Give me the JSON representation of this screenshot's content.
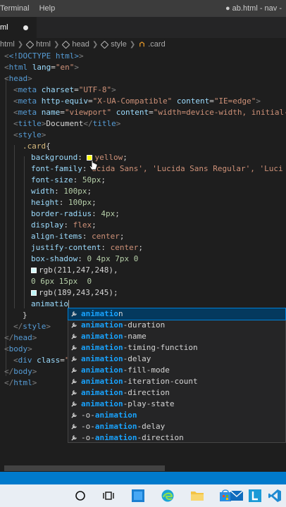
{
  "menubar": {
    "items": [
      "Terminal",
      "Help"
    ],
    "window_title": "● ab.html - nav -"
  },
  "tab": {
    "label": "ml"
  },
  "breadcrumb": {
    "items": [
      "html",
      "html",
      "head",
      "style",
      ".card"
    ]
  },
  "code": {
    "l1": "<!DOCTYPE html>",
    "l2_tag": "html",
    "l2_attr": "lang",
    "l2_val": "\"en\"",
    "l3_tag": "head",
    "l4_tag": "meta",
    "l4_attr": "charset",
    "l4_val": "\"UTF-8\"",
    "l5_tag": "meta",
    "l5_attr1": "http-equiv",
    "l5_val1": "\"X-UA-Compatible\"",
    "l5_attr2": "content",
    "l5_val2": "\"IE=edge\"",
    "l6_tag": "meta",
    "l6_attr1": "name",
    "l6_val1": "\"viewport\"",
    "l6_attr2": "content",
    "l6_val2": "\"width=device-width, initial-s",
    "l7_tag": "title",
    "l7_text": "Document",
    "l8_tag": "style",
    "l9_sel": ".card",
    "l10_prop": "background",
    "l10_val": "yellow",
    "l11_prop": "font-family",
    "l11_val": "ucida Sans', 'Lucida Sans Regular', 'Luci",
    "l12_prop": "font-size",
    "l12_val": "50px",
    "l13_prop": "width",
    "l13_val": "100px",
    "l14_prop": "height",
    "l14_val": "100px",
    "l15_prop": "border-radius",
    "l15_val": "4px",
    "l16_prop": "display",
    "l16_val": "flex",
    "l17_prop": "align-items",
    "l17_val": "center",
    "l18_prop": "justify-content",
    "l18_val": "center",
    "l19_prop": "box-shadow",
    "l19_val": "0 4px 7px 0",
    "l20_val": "rgb(211,247,248),",
    "l21_val": "0 6px 15px  0",
    "l22_val": "rgb(189,243,245);",
    "l23_typed": "animatio",
    "l24": "}",
    "l25_tag": "style",
    "l26_tag": "head",
    "l27_tag": "body",
    "l28_tag": "div",
    "l28_attr": "class",
    "l28_val": "\"",
    "l29_tag": "body",
    "l30_tag": "html"
  },
  "suggestions": {
    "s0_pre": "animatio",
    "s0_post": "n",
    "s1_pre": "animation",
    "s1_post": "-duration",
    "s2_pre": "animation",
    "s2_post": "-name",
    "s3_pre": "animation",
    "s3_post": "-timing-function",
    "s4_pre": "animation",
    "s4_post": "-delay",
    "s5_pre": "animation",
    "s5_post": "-fill-mode",
    "s6_pre": "animation",
    "s6_post": "-iteration-count",
    "s7_pre": "animation",
    "s7_post": "-direction",
    "s8_pre": "animation",
    "s8_post": "-play-state",
    "s9_a": "-o-",
    "s9_pre": "animation",
    "s9_post": "",
    "s10_a": "-o-",
    "s10_pre": "animation",
    "s10_post": "-delay",
    "s11_a": "-o-",
    "s11_pre": "animation",
    "s11_post": "-direction"
  },
  "colors": {
    "swatch_yellow": "#ffff00",
    "swatch_rgb1": "#d3f7f8",
    "swatch_rgb2": "#bdf3f5",
    "statusbar": "#007acc",
    "accent": "#18a3ff"
  },
  "taskbar": {
    "icons": [
      "search-circle-icon",
      "task-view-icon",
      "window-icon",
      "edge-icon",
      "folder-icon",
      "store-icon",
      "mail-icon",
      "l-app-icon",
      "vscode-icon"
    ]
  }
}
